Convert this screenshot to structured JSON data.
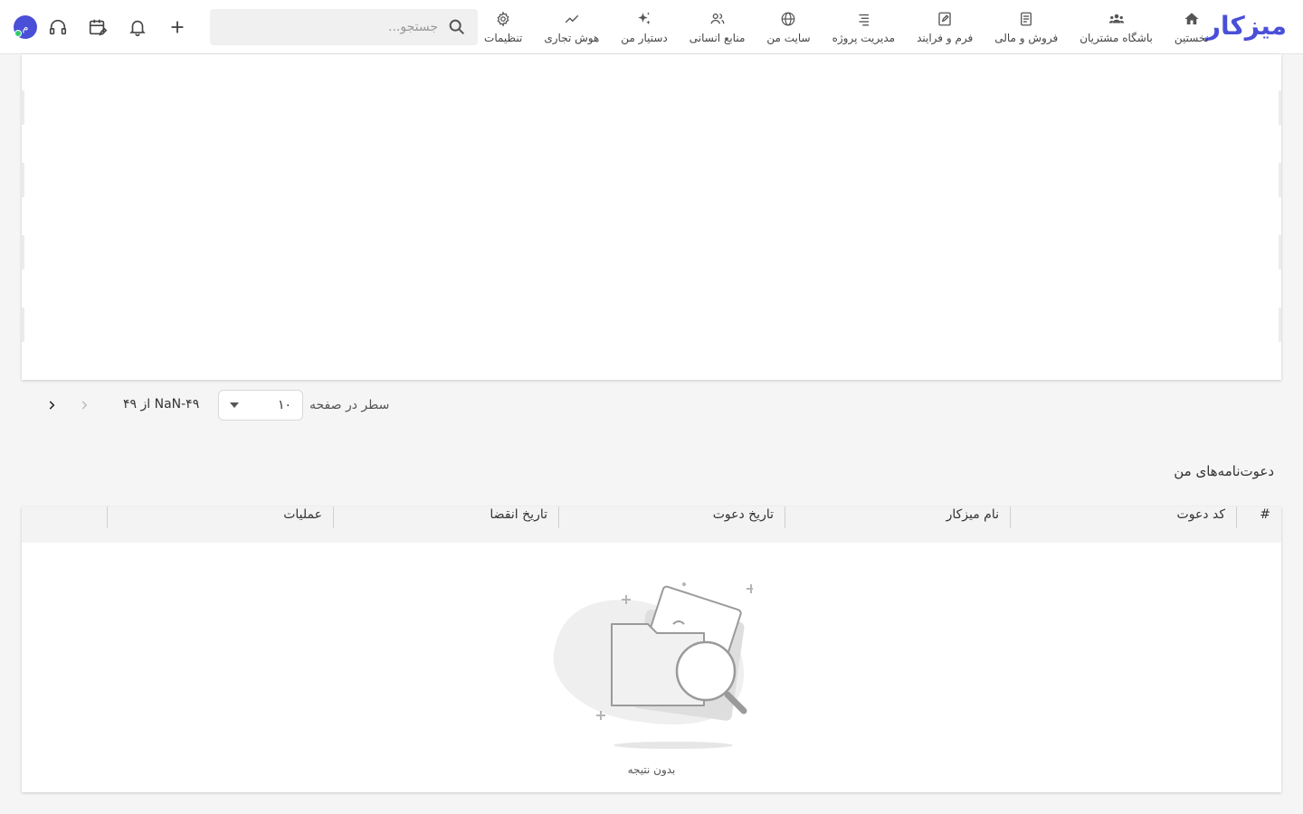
{
  "app": {
    "logo": "میزکار",
    "brand_color": "#4a4fd8"
  },
  "nav": [
    {
      "label": "نخستین",
      "icon": "home-icon"
    },
    {
      "label": "باشگاه مشتریان",
      "icon": "groups-icon"
    },
    {
      "label": "فروش و مالی",
      "icon": "receipt-icon"
    },
    {
      "label": "فرم و فرایند",
      "icon": "edit-note-icon"
    },
    {
      "label": "مدیریت پروژه",
      "icon": "lines-icon"
    },
    {
      "label": "سایت من",
      "icon": "globe-icon"
    },
    {
      "label": "منابع انسانی",
      "icon": "people-icon"
    },
    {
      "label": "دستیار من",
      "icon": "sparkle-icon"
    },
    {
      "label": "هوش تجاری",
      "icon": "trend-icon"
    },
    {
      "label": "تنظیمات",
      "icon": "gear-icon"
    }
  ],
  "search": {
    "placeholder": "جستجو..."
  },
  "toolbar": {
    "avatar_initial": "م"
  },
  "pagination": {
    "rows_label": "سطر در صفحه",
    "rows_value": "۱۰",
    "range_text": "NaN-۴۹ از ۴۹"
  },
  "invitations": {
    "title": "دعوت‌نامه‌های من",
    "columns": [
      "#",
      "کد دعوت",
      "نام میزکار",
      "تاریخ دعوت",
      "تاریخ انقضا",
      "عملیات"
    ],
    "empty_text": "بدون نتیجه"
  }
}
